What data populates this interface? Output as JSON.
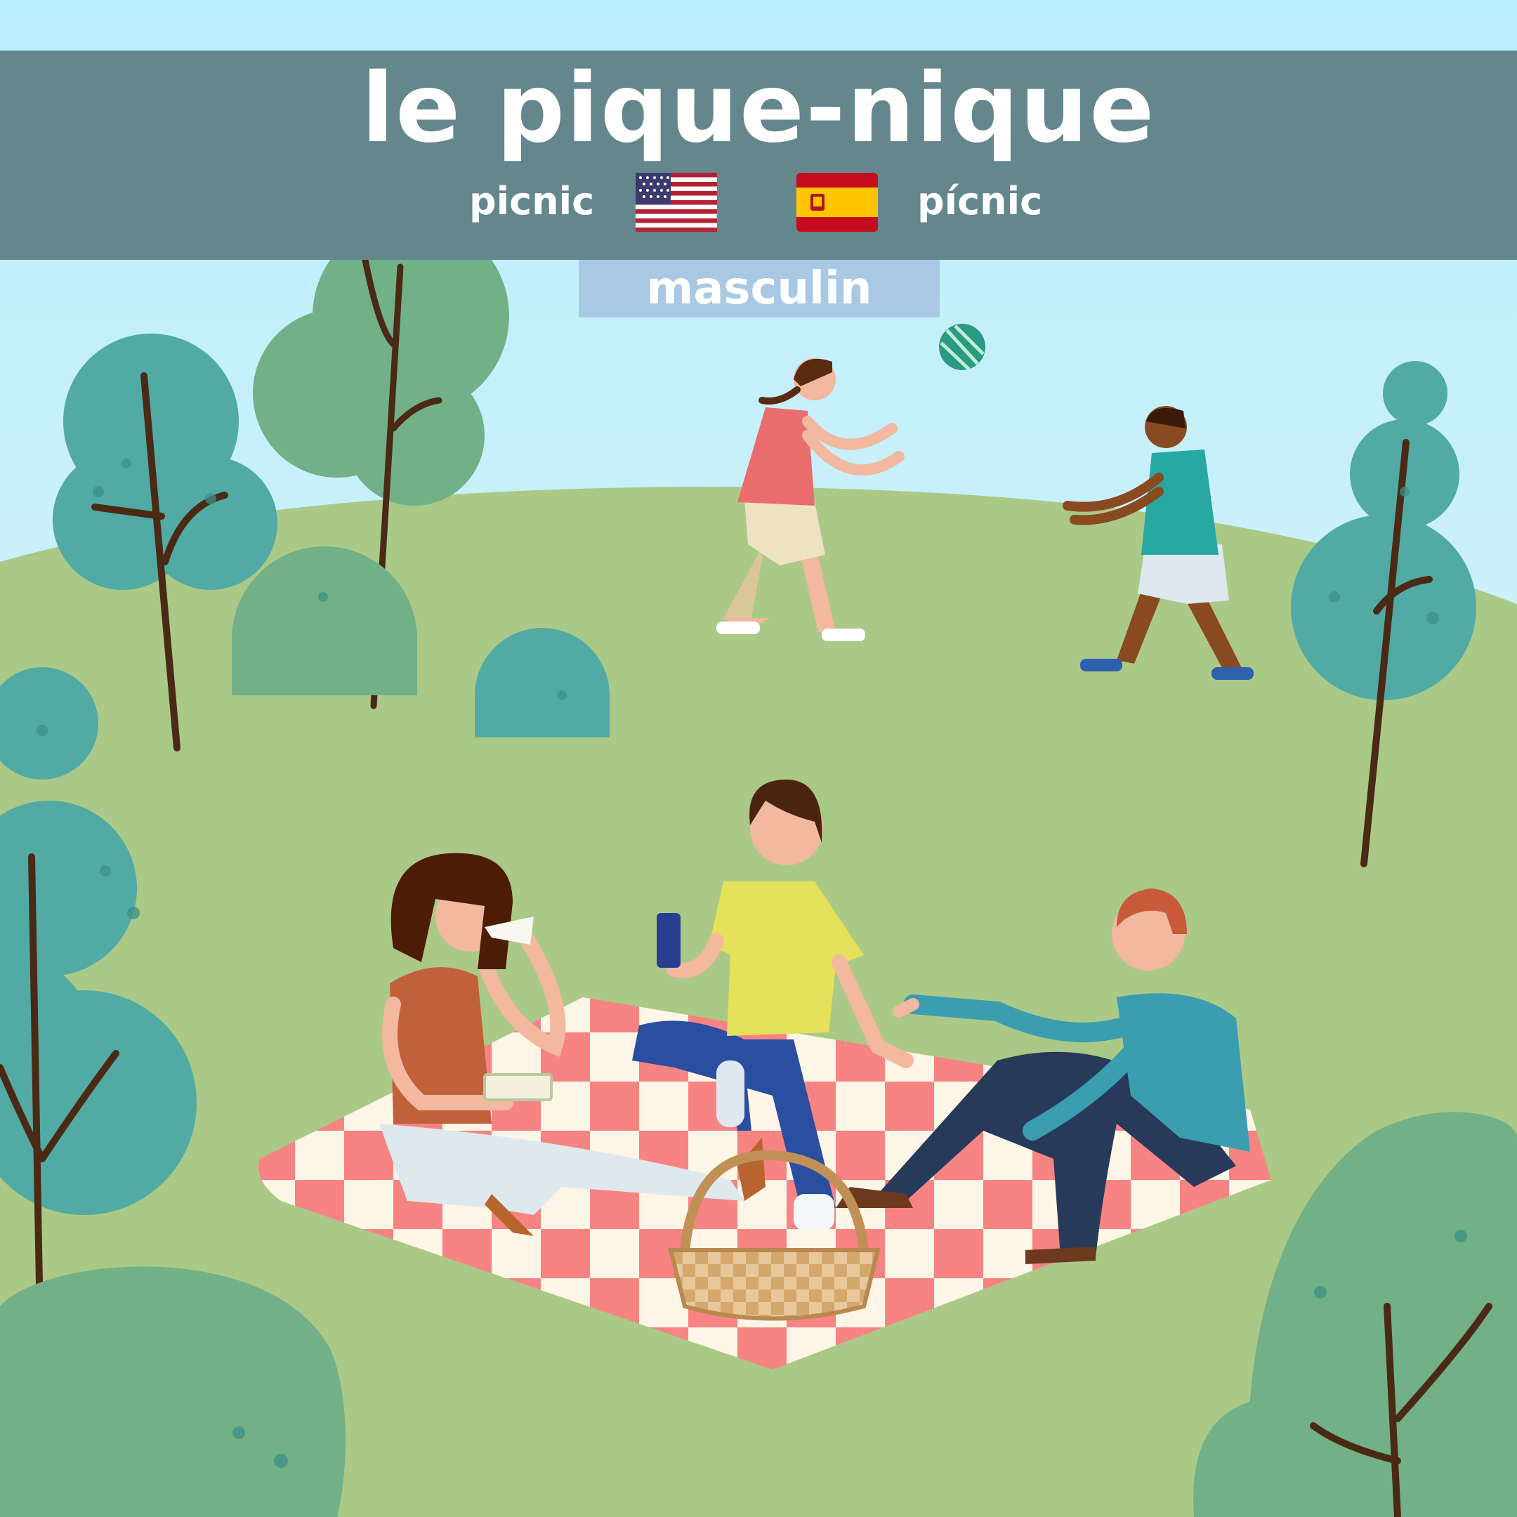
{
  "title": "le pique-nique",
  "translations": {
    "english": "picnic",
    "spanish": "pícnic"
  },
  "gender": "masculin",
  "flags": {
    "english": "us-flag-icon",
    "spanish": "spain-flag-icon"
  },
  "colors": {
    "sky": "#b9eefb",
    "hill": "#abc986",
    "banner": "#64868d",
    "gender_badge": "#a9c8e3",
    "blanket_red": "#f88383",
    "blanket_cream": "#fdf6e6",
    "tree_teal": "#52aaa4",
    "tree_green": "#72b088",
    "trunk": "#4a2a15"
  }
}
